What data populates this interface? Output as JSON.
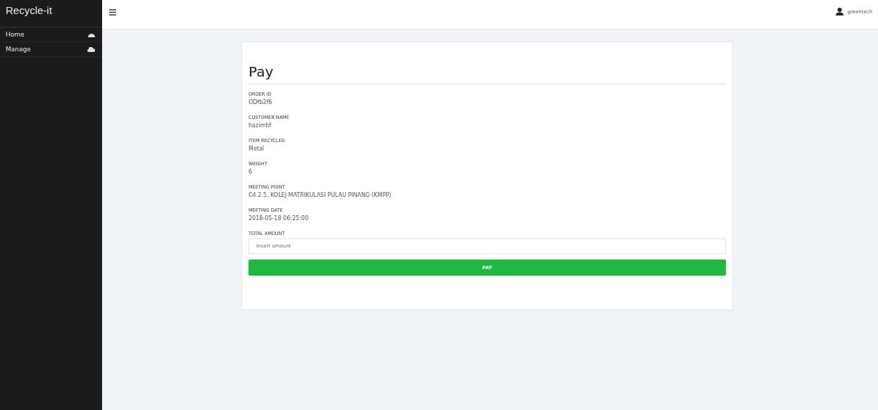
{
  "sidebar": {
    "brand": "Recycle-it",
    "items": [
      {
        "label": "Home"
      },
      {
        "label": "Manage"
      }
    ]
  },
  "topbar": {
    "user": "greentech"
  },
  "form": {
    "title": "Pay",
    "fields": [
      {
        "label": "ORDER ID",
        "value": "ODfb2f6"
      },
      {
        "label": "CUSTOMER NAME",
        "value": "hazimhf"
      },
      {
        "label": "ITEM RECYCLED",
        "value": "Metal"
      },
      {
        "label": "WEIGHT",
        "value": "6"
      },
      {
        "label": "MEETING POINT",
        "value": "C4.2.5, KOLEJ MATRIKULASI PULAU PINANG (KMPP)"
      },
      {
        "label": "MEETING DATE",
        "value": "2018-05-18 06:25:00"
      }
    ],
    "amount": {
      "label": "TOTAL AMOUNT",
      "placeholder": "Insert amount"
    },
    "button": "PAY"
  }
}
